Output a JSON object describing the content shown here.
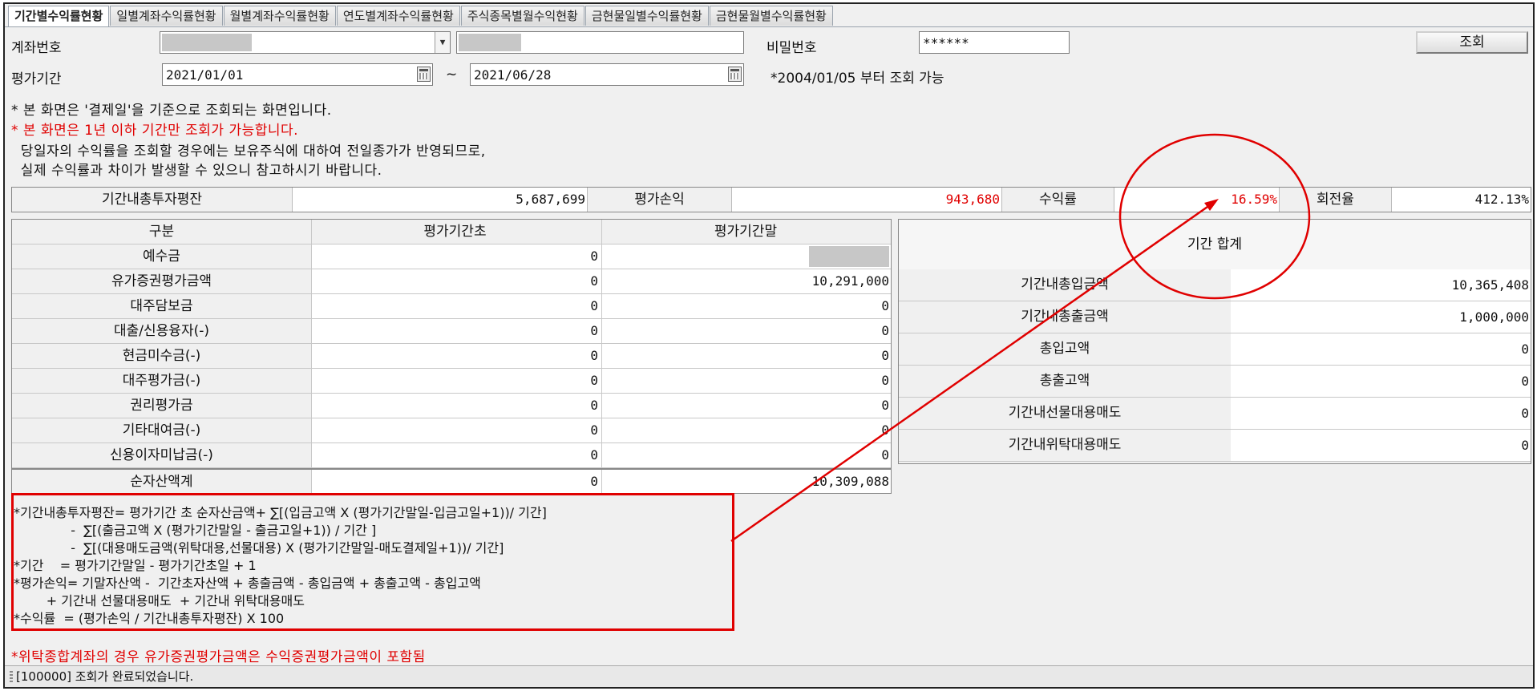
{
  "tabs": [
    "기간별수익률현황",
    "일별계좌수익률현황",
    "월별계좌수익률현황",
    "연도별계좌수익률현황",
    "주식종목별월수익현황",
    "금현물일별수익률현황",
    "금현물월별수익률현황"
  ],
  "form": {
    "account_label": "계좌번호",
    "password_label": "비밀번호",
    "password_value": "******",
    "query_button": "조회",
    "period_label": "평가기간",
    "start_date": "2021/01/01",
    "tilde": "~",
    "end_date": "2021/06/28",
    "date_hint": "*2004/01/05 부터 조회 가능"
  },
  "notes": {
    "line1": "* 본 화면은 '결제일'을 기준으로 조회되는 화면입니다.",
    "line2": "* 본 화면은 1년 이하 기간만 조회가 가능합니다.",
    "line3": "  당일자의 수익률을 조회할 경우에는 보유주식에 대하여 전일종가가 반영되므로,",
    "line4": "  실제 수익률과 차이가 발생할 수 있으니 참고하시기 바랍니다."
  },
  "summary": {
    "avg_invest_label": "기간내총투자평잔",
    "avg_invest_value": "5,687,699",
    "pnl_label": "평가손익",
    "pnl_value": "943,680",
    "return_label": "수익률",
    "return_value": "16.59%",
    "turnover_label": "회전율",
    "turnover_value": "412.13%"
  },
  "left_table": {
    "headers": [
      "구분",
      "평가기간초",
      "평가기간말"
    ],
    "rows": [
      {
        "label": "예수금",
        "start": "0",
        "end": ""
      },
      {
        "label": "유가증권평가금액",
        "start": "0",
        "end": "10,291,000"
      },
      {
        "label": "대주담보금",
        "start": "0",
        "end": "0"
      },
      {
        "label": "대출/신용융자(-)",
        "start": "0",
        "end": "0"
      },
      {
        "label": "현금미수금(-)",
        "start": "0",
        "end": "0"
      },
      {
        "label": "대주평가금(-)",
        "start": "0",
        "end": "0"
      },
      {
        "label": "권리평가금",
        "start": "0",
        "end": "0"
      },
      {
        "label": "기타대여금(-)",
        "start": "0",
        "end": "0"
      },
      {
        "label": "신용이자미납금(-)",
        "start": "0",
        "end": "0"
      }
    ],
    "total": {
      "label": "순자산액계",
      "start": "0",
      "end": "10,309,088"
    }
  },
  "right_table": {
    "header": "기간 합계",
    "rows": [
      {
        "label": "기간내총입금액",
        "value": "10,365,408"
      },
      {
        "label": "기간내총출금액",
        "value": "1,000,000"
      },
      {
        "label": "총입고액",
        "value": "0"
      },
      {
        "label": "총출고액",
        "value": "0"
      },
      {
        "label": "기간내선물대용매도",
        "value": "0"
      },
      {
        "label": "기간내위탁대용매도",
        "value": "0"
      }
    ]
  },
  "formula": [
    "*기간내총투자평잔= 평가기간 초 순자산금액+ ∑[(입금고액 X (평가기간말일-입금고일+1))/ 기간]",
    "              -  ∑[(출금고액 X (평가기간말일 - 출금고일+1)) / 기간 ]",
    "              -  ∑[(대용매도금액(위탁대용,선물대용) X (평가기간말일-매도결제일+1))/ 기간]",
    "*기간    = 평가기간말일 - 평가기간초일 + 1",
    "*평가손익= 기말자산액 -  기간초자산액 + 총출금액 - 총입금액 + 총출고액 - 총입고액",
    "        + 기간내 선물대용매도  + 기간내 위탁대용매도",
    "*수익률  = (평가손익 / 기간내총투자평잔) X 100"
  ],
  "footer_note": "*위탁종합계좌의 경우 유가증권평가금액은 수익증권평가금액이 포함됨",
  "status": "[100000] 조회가 완료되었습니다.",
  "colors": {
    "accent_red": "#e00000",
    "panel_bg": "#f0f0f0",
    "mask": "#c7c7c7"
  }
}
